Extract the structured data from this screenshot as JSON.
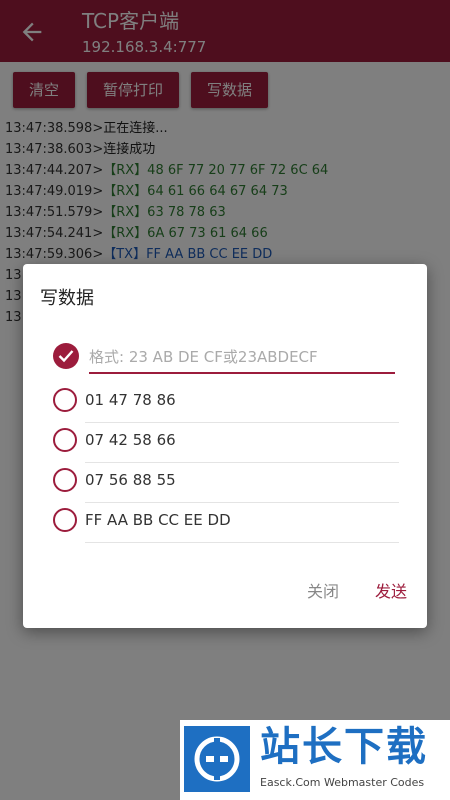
{
  "appbar": {
    "title": "TCP客户端",
    "subtitle": "192.168.3.4:777"
  },
  "toolbar": {
    "clear_label": "清空",
    "pause_label": "暂停打印",
    "write_label": "写数据"
  },
  "log": [
    {
      "time": "13:47:38.598>",
      "text": "正在连接...",
      "kind": "sys"
    },
    {
      "time": "13:47:38.603>",
      "text": "连接成功",
      "kind": "sys"
    },
    {
      "time": "13:47:44.207>",
      "text": "【RX】48 6F 77 20 77 6F 72 6C 64",
      "kind": "rx"
    },
    {
      "time": "13:47:49.019>",
      "text": "【RX】64 61 66 64 67 64 73",
      "kind": "rx"
    },
    {
      "time": "13:47:51.579>",
      "text": "【RX】63 78 78 63",
      "kind": "rx"
    },
    {
      "time": "13:47:54.241>",
      "text": "【RX】6A 67 73 61 64 66",
      "kind": "rx"
    },
    {
      "time": "13:47:59.306>",
      "text": "【TX】FF AA BB CC EE DD",
      "kind": "tx"
    },
    {
      "time": "13",
      "text": "",
      "kind": "sys"
    },
    {
      "time": "13",
      "text": "",
      "kind": "sys"
    },
    {
      "time": "13",
      "text": "",
      "kind": "sys"
    }
  ],
  "dialog": {
    "title": "写数据",
    "input_placeholder": "格式: 23 AB DE CF或23ABDECF",
    "options": [
      "01 47 78 86",
      "07 42 58 66",
      "07 56 88 55",
      "FF AA BB CC EE DD"
    ],
    "close_label": "关闭",
    "send_label": "发送"
  },
  "watermark": {
    "main": "站长下载",
    "sub": "Easck.Com Webmaster Codes"
  },
  "colors": {
    "primary": "#9c1c3c",
    "rx": "#2e7d32",
    "tx": "#1e5bb8"
  }
}
